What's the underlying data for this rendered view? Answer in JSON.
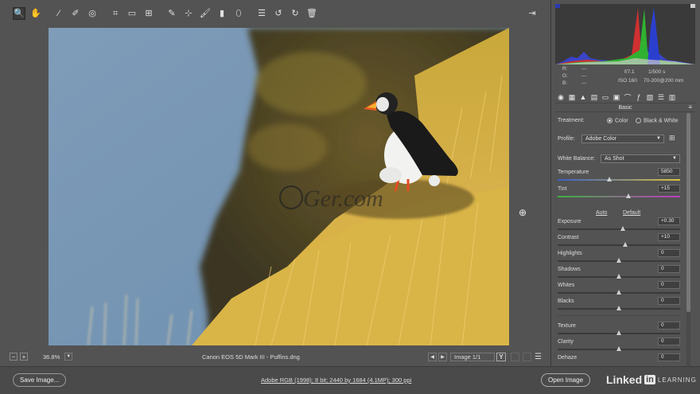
{
  "toolbar": {
    "tools": [
      {
        "name": "zoom-tool-icon",
        "glyph": "🔍",
        "active": true
      },
      {
        "name": "hand-tool-icon",
        "glyph": "✋"
      },
      {
        "name": "white-balance-tool-icon",
        "glyph": "⁄"
      },
      {
        "name": "color-sampler-tool-icon",
        "glyph": "✐"
      },
      {
        "name": "targeted-adjustment-tool-icon",
        "glyph": "◎"
      },
      {
        "name": "crop-tool-icon",
        "glyph": "⌗"
      },
      {
        "name": "straighten-tool-icon",
        "glyph": "▭"
      },
      {
        "name": "transform-tool-icon",
        "glyph": "⊞"
      },
      {
        "name": "spot-removal-tool-icon",
        "glyph": "✎"
      },
      {
        "name": "red-eye-tool-icon",
        "glyph": "⊹"
      },
      {
        "name": "adjustment-brush-icon",
        "glyph": "🖌"
      },
      {
        "name": "graduated-filter-icon",
        "glyph": "▮"
      },
      {
        "name": "radial-filter-icon",
        "glyph": "⬯"
      },
      {
        "name": "preferences-icon",
        "glyph": "☰"
      },
      {
        "name": "rotate-ccw-icon",
        "glyph": "↺"
      },
      {
        "name": "rotate-cw-icon",
        "glyph": "↻"
      },
      {
        "name": "trash-icon",
        "glyph": "🗑"
      }
    ],
    "fullscreen_glyph": "⇥"
  },
  "status": {
    "minus": "−",
    "plus": "+",
    "zoom": "36.8%",
    "file": "Canon EOS 5D Mark III  -  Puffins.dng",
    "prev": "◀",
    "next": "▶",
    "image_index": "Image 1/1",
    "compare": "Y",
    "settings_glyph": "☰"
  },
  "bottom": {
    "save_label": "Save Image...",
    "workflow": "Adobe RGB (1998); 8 bit; 2440 by 1684 (4.1MP); 300 ppi",
    "open_label": "Open Image",
    "brand_a": "Linked",
    "brand_in": "in",
    "brand_b": "LEARNING"
  },
  "meta": {
    "r_label": "R:",
    "g_label": "G:",
    "b_label": "B:",
    "r_val": "---",
    "g_val": "---",
    "b_val": "---",
    "aperture": "f/7.1",
    "shutter": "1/500 s",
    "iso": "ISO 160",
    "lens": "70-200@200 mm"
  },
  "panel": {
    "title": "Basic",
    "treatment_label": "Treatment:",
    "treatment_color": "Color",
    "treatment_bw": "Black & White",
    "profile_label": "Profile:",
    "profile_value": "Adobe Color",
    "wb_label": "White Balance:",
    "wb_value": "As Shot",
    "auto_label": "Auto",
    "default_label": "Default",
    "sliders": {
      "temperature": {
        "label": "Temperature",
        "value": "5850",
        "pos": 0.42
      },
      "tint": {
        "label": "Tint",
        "value": "+15",
        "pos": 0.58
      },
      "exposure": {
        "label": "Exposure",
        "value": "+0.30",
        "pos": 0.53
      },
      "contrast": {
        "label": "Contrast",
        "value": "+10",
        "pos": 0.55
      },
      "highlights": {
        "label": "Highlights",
        "value": "0",
        "pos": 0.5
      },
      "shadows": {
        "label": "Shadows",
        "value": "0",
        "pos": 0.5
      },
      "whites": {
        "label": "Whites",
        "value": "0",
        "pos": 0.5
      },
      "blacks": {
        "label": "Blacks",
        "value": "0",
        "pos": 0.5
      },
      "texture": {
        "label": "Texture",
        "value": "0",
        "pos": 0.5
      },
      "clarity": {
        "label": "Clarity",
        "value": "0",
        "pos": 0.5
      },
      "dehaze": {
        "label": "Dehaze",
        "value": "0",
        "pos": 0.5
      }
    }
  },
  "colors": {
    "panel_bg": "#535353",
    "temp_track_start": "#3a5ec8",
    "temp_track_end": "#d8c23a",
    "tint_track_start": "#3fb040",
    "tint_track_end": "#c03ac0"
  }
}
